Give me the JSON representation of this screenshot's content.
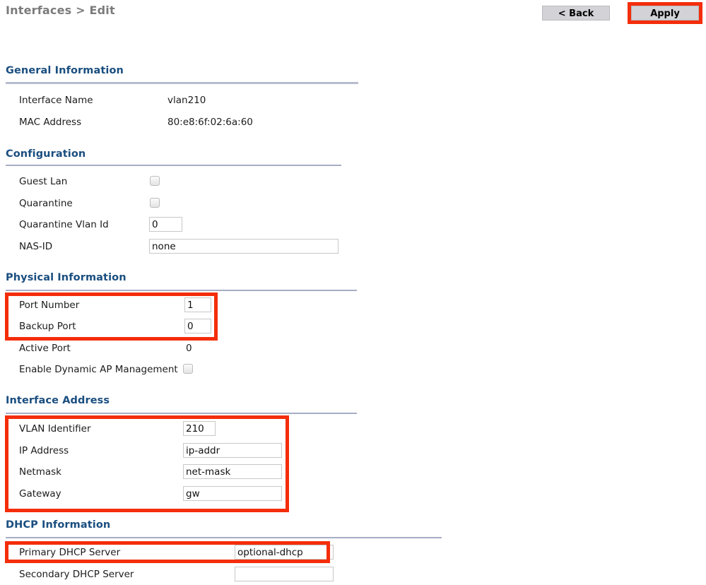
{
  "header": {
    "breadcrumb": "Interfaces > Edit",
    "back_label": "< Back",
    "apply_label": "Apply"
  },
  "colors": {
    "heading_blue": "#1a4e7f",
    "highlight_red": "#f42d0a",
    "button_gray": "#d2d2d7",
    "divider": "#a6adc4"
  },
  "sections": {
    "general": {
      "title": "General Information",
      "rows": [
        {
          "label": "Interface Name",
          "value": "vlan210"
        },
        {
          "label": "MAC Address",
          "value": "80:e8:6f:02:6a:60"
        }
      ]
    },
    "configuration": {
      "title": "Configuration",
      "guest_lan_label": "Guest Lan",
      "guest_lan_checked": false,
      "quarantine_label": "Quarantine",
      "quarantine_checked": false,
      "quarantine_vlan_label": "Quarantine Vlan Id",
      "quarantine_vlan_value": "0",
      "nas_id_label": "NAS-ID",
      "nas_id_value": "none"
    },
    "physical": {
      "title": "Physical Information",
      "port_number_label": "Port Number",
      "port_number_value": "1",
      "backup_port_label": "Backup Port",
      "backup_port_value": "0",
      "active_port_label": "Active Port",
      "active_port_value": "0",
      "dynamic_ap_label": "Enable Dynamic AP Management",
      "dynamic_ap_checked": false
    },
    "interface_address": {
      "title": "Interface Address",
      "vlan_identifier_label": "VLAN Identifier",
      "vlan_identifier_value": "210",
      "ip_address_label": "IP Address",
      "ip_address_value": "ip-addr",
      "netmask_label": "Netmask",
      "netmask_value": "net-mask",
      "gateway_label": "Gateway",
      "gateway_value": "gw"
    },
    "dhcp": {
      "title": "DHCP Information",
      "primary_label": "Primary DHCP Server",
      "primary_value": "optional-dhcp",
      "secondary_label": "Secondary DHCP Server",
      "secondary_value": ""
    }
  }
}
